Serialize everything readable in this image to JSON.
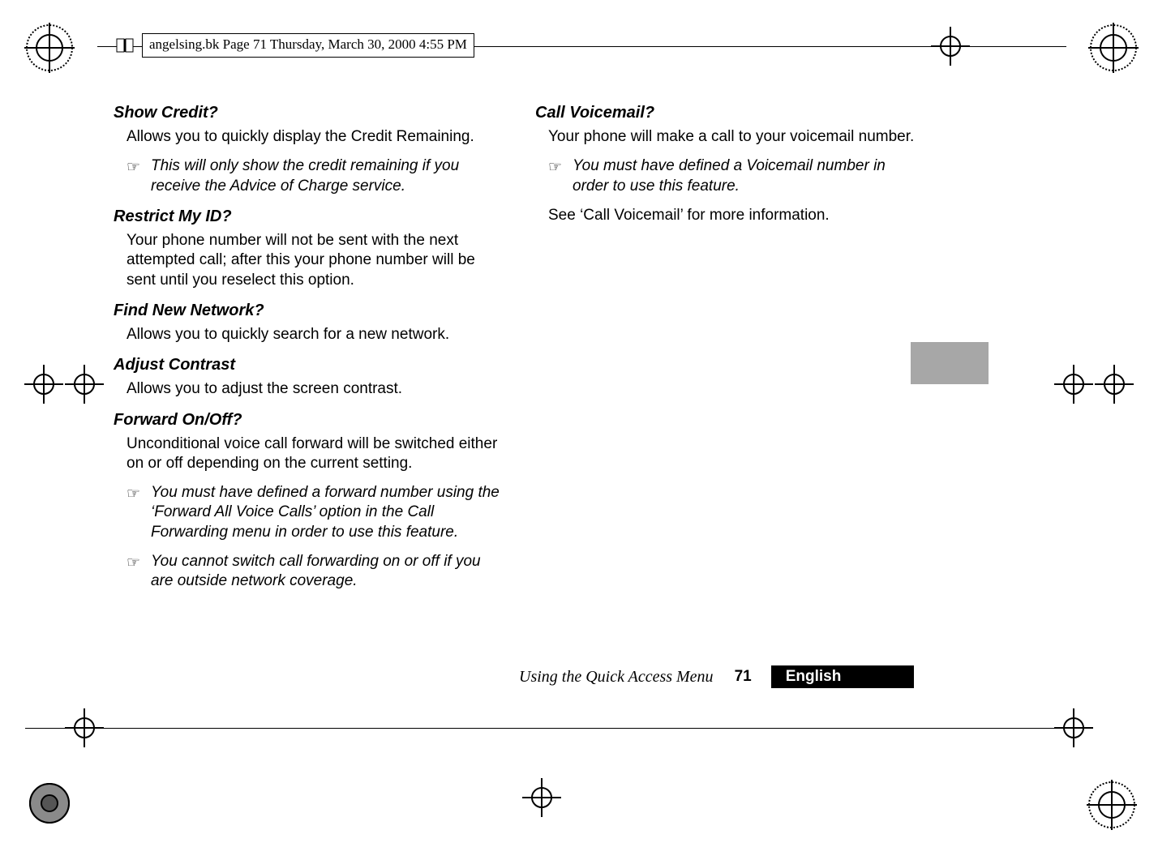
{
  "header": {
    "file_line": "angelsing.bk  Page 71  Thursday, March 30, 2000  4:55 PM"
  },
  "left_column": {
    "show_credit": {
      "heading": "Show Credit?",
      "body": "Allows you to quickly display the Credit Remaining.",
      "note": "This will only show the credit remaining if you receive the Advice of Charge service."
    },
    "restrict_my_id": {
      "heading": "Restrict My ID?",
      "body": "Your phone number will not be sent with the next attempted call; after this your phone number will be sent until you reselect this option."
    },
    "find_new_network": {
      "heading": "Find New Network?",
      "body": "Allows you to quickly search for a new network."
    },
    "adjust_contrast": {
      "heading": "Adjust Contrast",
      "body": "Allows you to adjust the screen contrast."
    },
    "forward": {
      "heading": "Forward On/Off?",
      "body": "Unconditional voice call forward will be switched either on or off depending on the current setting.",
      "note1": "You must have defined a forward number using the ‘Forward All Voice Calls’ option in the Call Forwarding menu in order to use this feature.",
      "note2": "You cannot switch call forwarding on or off if you are outside network coverage."
    }
  },
  "right_column": {
    "call_voicemail": {
      "heading": "Call Voicemail?",
      "body": "Your phone will make a call to your voicemail number.",
      "note": "You must have defined a Voicemail number in order to use this feature.",
      "see": "See ‘Call Voicemail’ for more information."
    }
  },
  "footer": {
    "running_title": "Using the Quick Access Menu",
    "page_number": "71",
    "language": "English"
  },
  "icons": {
    "hand": "☞"
  }
}
